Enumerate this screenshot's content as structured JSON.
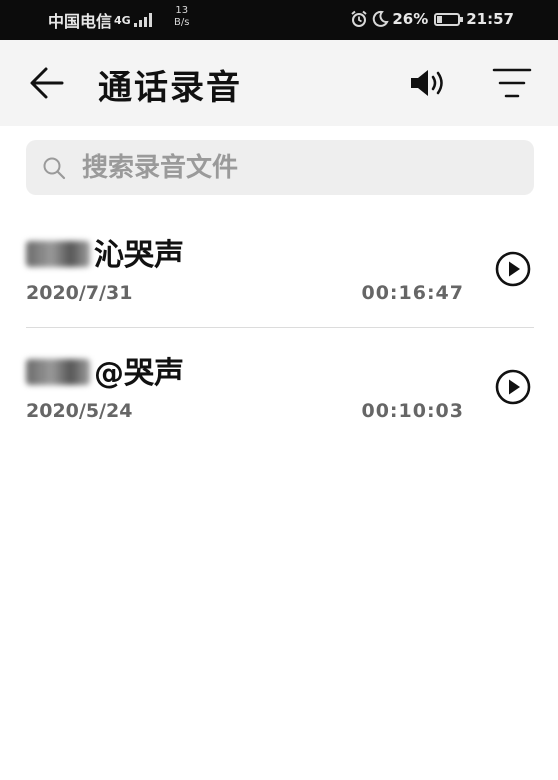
{
  "status_bar": {
    "carrier": "中国电信",
    "network": "4G",
    "speed_value": "13",
    "speed_unit": "B/s",
    "battery": "26%",
    "battery_level": 0.26,
    "time": "21:57"
  },
  "header": {
    "title": "通话录音"
  },
  "search": {
    "placeholder": "搜索录音文件"
  },
  "recordings": [
    {
      "name_visible": "沁哭声",
      "date": "2020/7/31",
      "duration": "00:16:47"
    },
    {
      "name_visible": "@哭声",
      "date": "2020/5/24",
      "duration": "00:10:03"
    }
  ],
  "icons": {
    "back": "arrow-left-icon",
    "speaker": "speaker-icon",
    "sort": "sort-icon",
    "search": "search-icon",
    "play": "play-icon",
    "alarm": "alarm-icon",
    "moon": "moon-icon"
  },
  "colors": {
    "status_bar_bg": "#0c0c0c",
    "app_bar_bg": "#f4f4f4",
    "search_bg": "#eeeeee",
    "primary_text": "#111111",
    "secondary_text": "#666666"
  }
}
